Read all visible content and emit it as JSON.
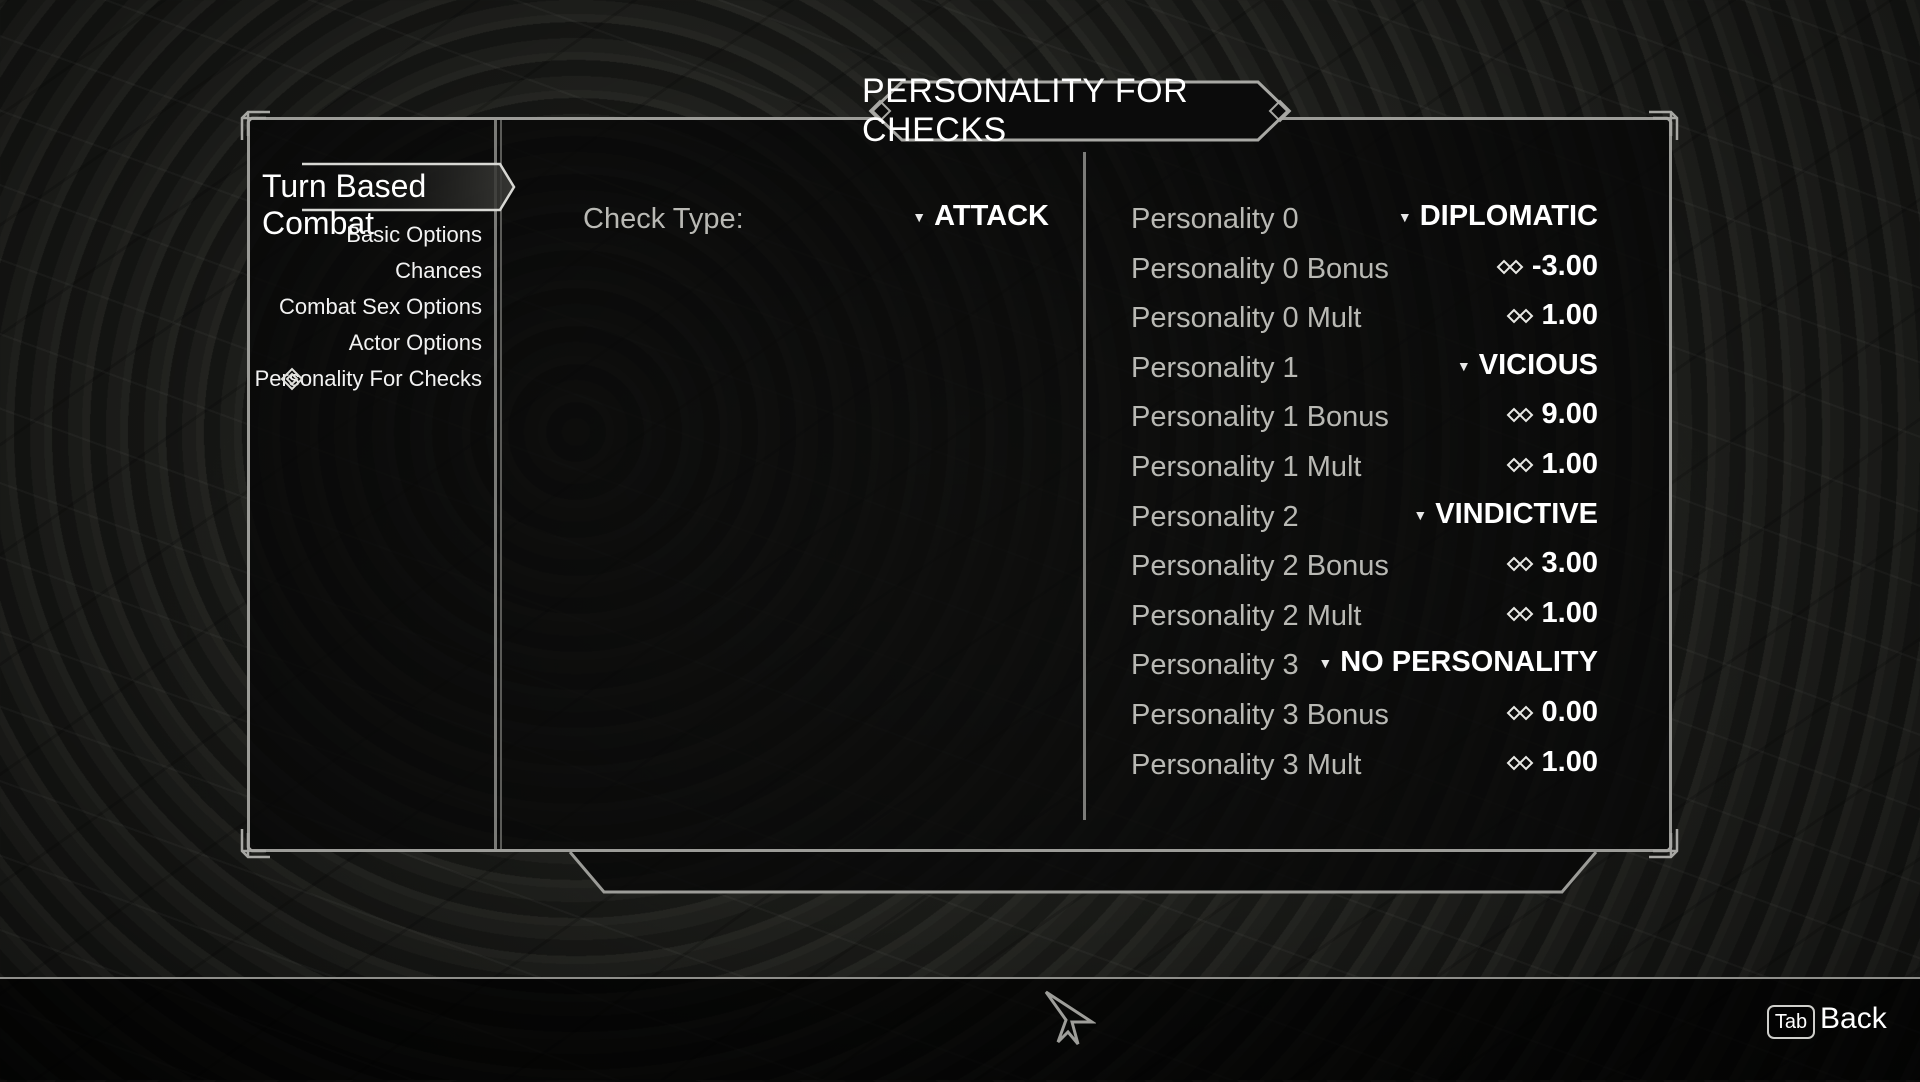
{
  "title": "PERSONALITY FOR CHECKS",
  "mod_name": "Turn Based Combat",
  "sidebar": {
    "items": [
      {
        "label": "Basic Options"
      },
      {
        "label": "Chances"
      },
      {
        "label": "Combat Sex Options"
      },
      {
        "label": "Actor Options"
      },
      {
        "label": "Personality For Checks",
        "selected": true
      }
    ]
  },
  "left_column": {
    "check_type_label": "Check Type:",
    "check_type_value": "ATTACK"
  },
  "rows": [
    {
      "label": "Personality 0",
      "value": "DIPLOMATIC",
      "kind": "dropdown"
    },
    {
      "label": "Personality 0 Bonus",
      "value": "-3.00",
      "kind": "slider"
    },
    {
      "label": "Personality 0 Mult",
      "value": "1.00",
      "kind": "slider"
    },
    {
      "label": "Personality 1",
      "value": "VICIOUS",
      "kind": "dropdown"
    },
    {
      "label": "Personality 1 Bonus",
      "value": "9.00",
      "kind": "slider"
    },
    {
      "label": "Personality 1 Mult",
      "value": "1.00",
      "kind": "slider"
    },
    {
      "label": "Personality 2",
      "value": "VINDICTIVE",
      "kind": "dropdown"
    },
    {
      "label": "Personality 2 Bonus",
      "value": "3.00",
      "kind": "slider"
    },
    {
      "label": "Personality 2 Mult",
      "value": "1.00",
      "kind": "slider"
    },
    {
      "label": "Personality 3",
      "value": "NO PERSONALITY",
      "kind": "dropdown"
    },
    {
      "label": "Personality 3 Bonus",
      "value": "0.00",
      "kind": "slider"
    },
    {
      "label": "Personality 3 Mult",
      "value": "1.00",
      "kind": "slider"
    }
  ],
  "footer": {
    "key": "Tab",
    "back_label": "Back"
  },
  "icons": {
    "dropdown": "dropdown-arrow-icon",
    "slider": "slider-icon",
    "selected": "selected-item-icon",
    "cursor": "mouse-cursor-icon"
  },
  "colors": {
    "frame": "#9c9c98",
    "label": "#b9b9b4",
    "value": "#ffffff"
  }
}
